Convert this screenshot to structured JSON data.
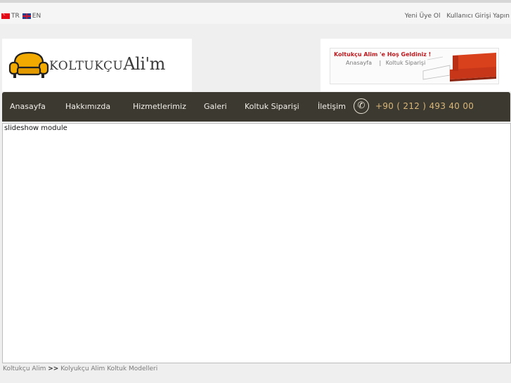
{
  "topbar": {
    "lang_tr": "TR",
    "lang_en": "EN",
    "register_link": "Yeni Üye Ol",
    "login_link": "Kullanıcı Girişi Yapın"
  },
  "logo": {
    "text_main": "Koltukçu",
    "text_name": "Ali'm"
  },
  "welcome": {
    "title": "Koltukçu Alim 'e Hoş Geldiniz !",
    "link_home": "Anasayfa",
    "divider": "|",
    "link_order": "Koltuk Siparişi"
  },
  "nav": {
    "items": [
      "Anasayfa",
      "Hakkımızda",
      "Hizmetlerimiz",
      "Galeri",
      "Koltuk Siparişi",
      "İletişim"
    ],
    "phone": "+90 ( 212 ) 493 40 00"
  },
  "slideshow": {
    "text": "slideshow module"
  },
  "breadcrumb": {
    "root": "Koltukçu Alim",
    "separator": ">>",
    "current": "Kolyukçu Alim Koltuk Modelleri"
  },
  "colors": {
    "nav_bg": "#3c3931",
    "phone_color": "#d9b779",
    "welcome_title": "#c0181d",
    "armchair": "#f2a900",
    "sofa": "#d9401c"
  }
}
